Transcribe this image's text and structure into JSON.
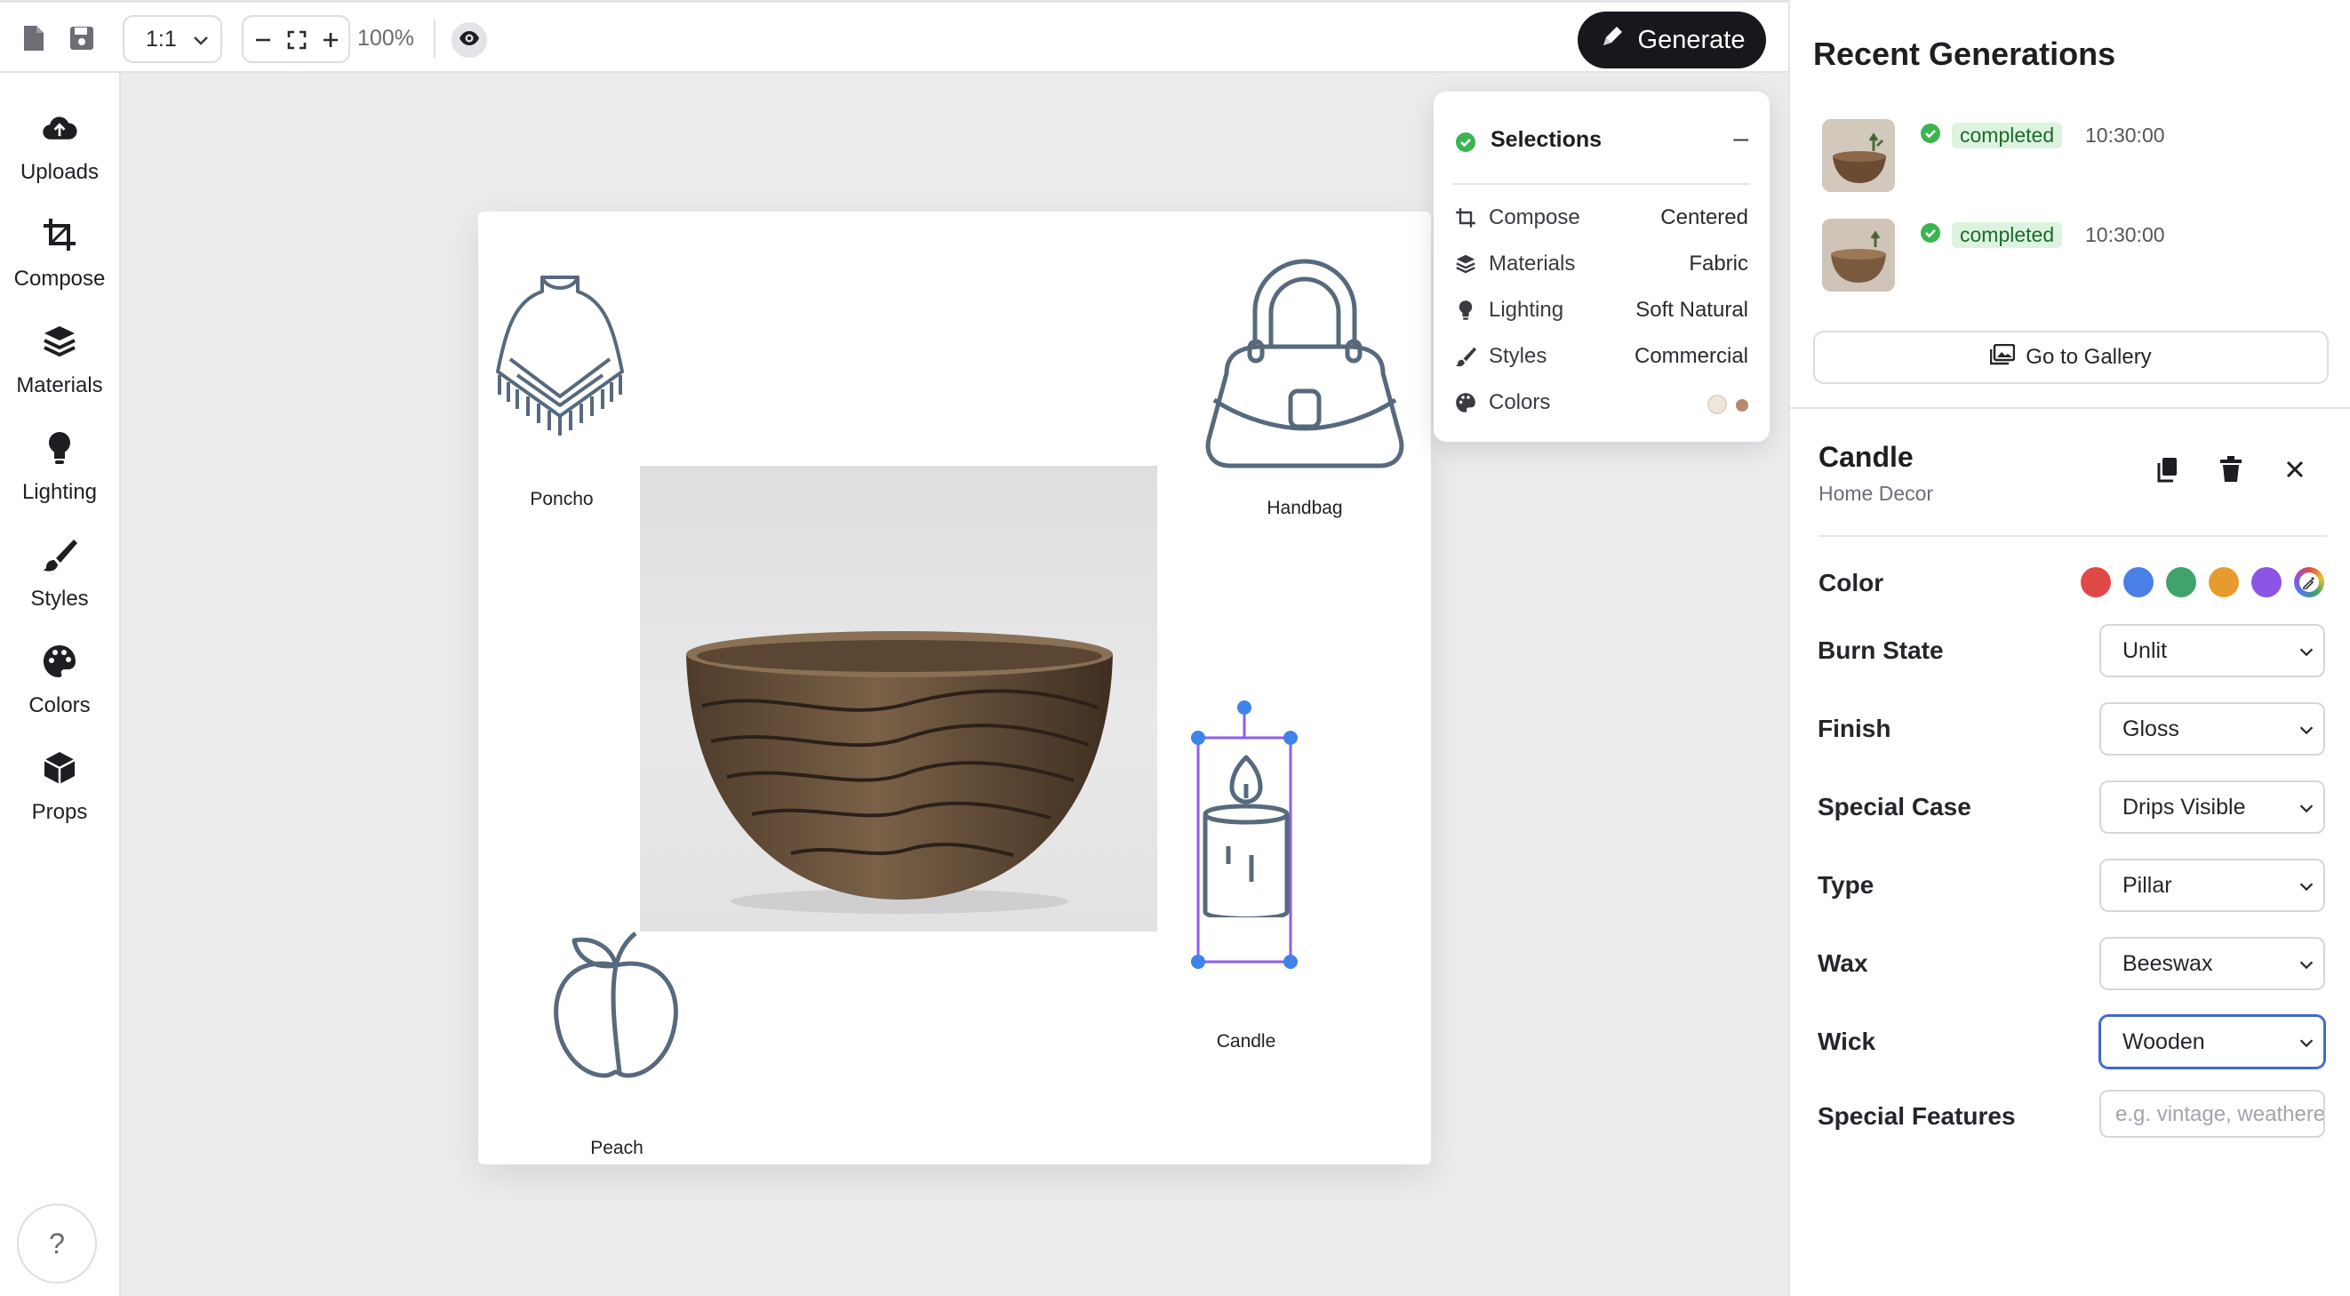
{
  "toolbar": {
    "aspect_ratio": "1:1",
    "zoom": "100%",
    "generate_label": "Generate"
  },
  "rail": {
    "items": [
      {
        "label": "Uploads",
        "icon": "cloud-upload-icon"
      },
      {
        "label": "Compose",
        "icon": "crop-icon"
      },
      {
        "label": "Materials",
        "icon": "layers-icon"
      },
      {
        "label": "Lighting",
        "icon": "bulb-icon"
      },
      {
        "label": "Styles",
        "icon": "brush-icon"
      },
      {
        "label": "Colors",
        "icon": "palette-icon"
      },
      {
        "label": "Props",
        "icon": "cube-icon"
      }
    ],
    "help_label": "?"
  },
  "canvas": {
    "props": [
      {
        "label": "Poncho"
      },
      {
        "label": "Handbag"
      },
      {
        "label": "Candle"
      },
      {
        "label": "Peach"
      }
    ]
  },
  "selections": {
    "title": "Selections",
    "collapse_label": "–",
    "rows": [
      {
        "label": "Compose",
        "value": "Centered"
      },
      {
        "label": "Materials",
        "value": "Fabric"
      },
      {
        "label": "Lighting",
        "value": "Soft Natural"
      },
      {
        "label": "Styles",
        "value": "Commercial"
      },
      {
        "label": "Colors",
        "value": ""
      }
    ],
    "color_swatches": [
      "#efe6dc",
      "#b58a6a"
    ]
  },
  "recent": {
    "title": "Recent Generations",
    "items": [
      {
        "status": "completed",
        "time": "10:30:00"
      },
      {
        "status": "completed",
        "time": "10:30:00"
      }
    ],
    "gallery_label": "Go to Gallery"
  },
  "item": {
    "title": "Candle",
    "category": "Home Decor",
    "color_label": "Color",
    "colors": [
      "#e04848",
      "#4a7fe6",
      "#3fa36b",
      "#e79b2e",
      "#8b55e6"
    ],
    "fields": [
      {
        "label": "Burn State",
        "value": "Unlit"
      },
      {
        "label": "Finish",
        "value": "Gloss"
      },
      {
        "label": "Special Case",
        "value": "Drips Visible"
      },
      {
        "label": "Type",
        "value": "Pillar"
      },
      {
        "label": "Wax",
        "value": "Beeswax"
      },
      {
        "label": "Wick",
        "value": "Wooden"
      }
    ],
    "special_features_label": "Special Features",
    "special_features_placeholder": "e.g. vintage, weathered"
  },
  "colors": {
    "accent": "#17171c",
    "icon_stroke": "#57697c",
    "status_green": "#3cb451",
    "selection_blue": "#3f82e8",
    "selection_purple": "#8b5cf6"
  }
}
